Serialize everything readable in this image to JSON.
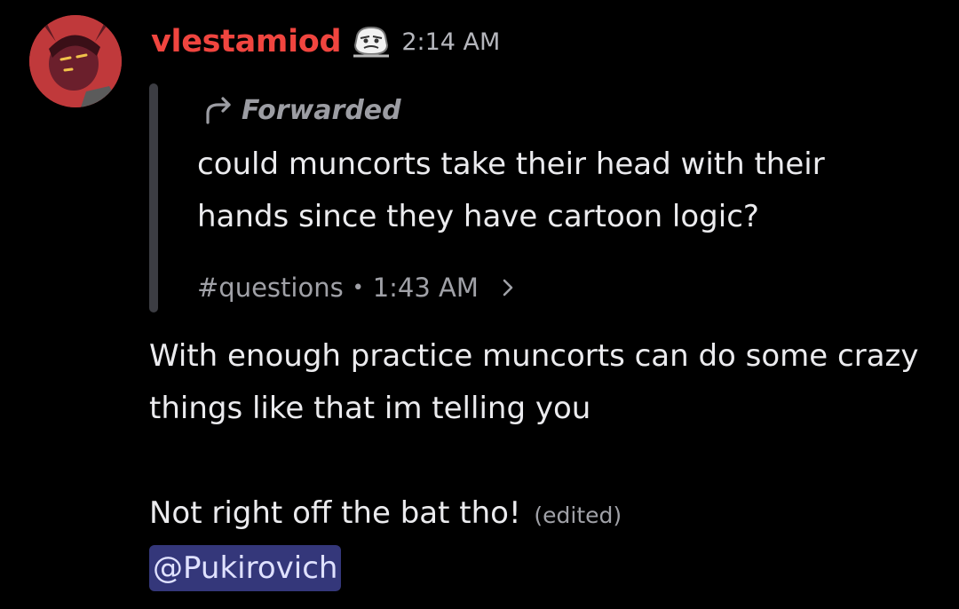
{
  "message": {
    "username": "vlestamiod",
    "timestamp": "2:14 AM",
    "username_color": "#f0453f",
    "avatar_icon": "user-avatar-icon",
    "badge_icon": "guild-tag-badge-icon"
  },
  "forwarded": {
    "label": "Forwarded",
    "icon": "forward-arrow-icon",
    "text": "could muncorts take their head with their hands since they have cartoon logic?",
    "channel": "#questions",
    "separator": "•",
    "time": "1:43 AM",
    "chevron_icon": "chevron-right-icon"
  },
  "reply": {
    "paragraph_1": "With enough practice muncorts can do some crazy things like that im telling you",
    "paragraph_2": "Not right off the bat tho!",
    "edited_label": "(edited)",
    "mention": "@Pukirovich",
    "mention_color": "#34377a"
  }
}
